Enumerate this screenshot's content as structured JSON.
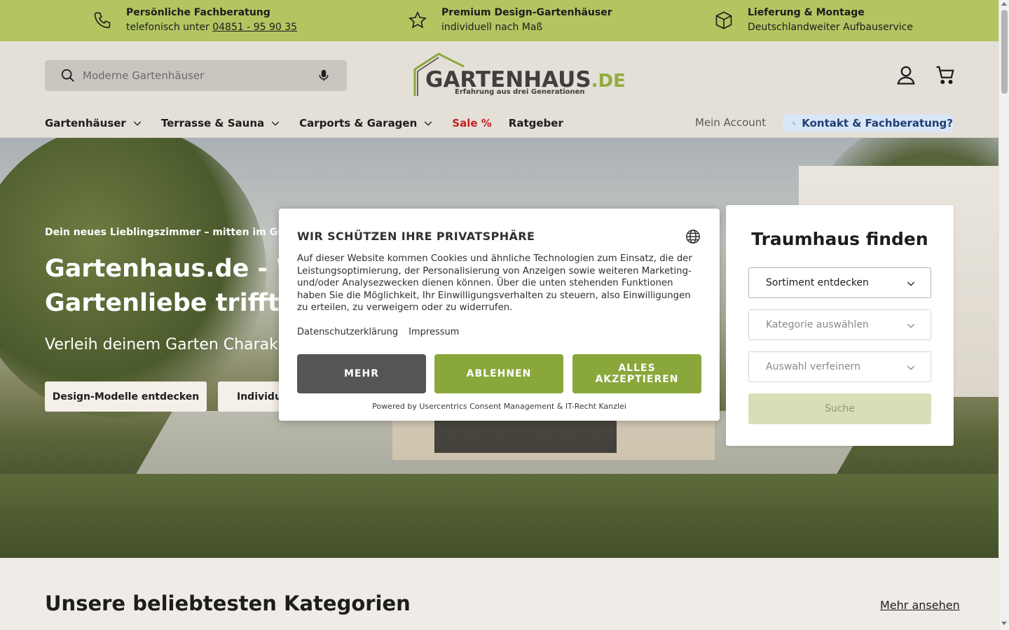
{
  "usp": [
    {
      "title": "Persönliche Fachberatung",
      "sub_prefix": "telefonisch unter ",
      "phone": "04851 - 95 90 35",
      "icon": "phone-icon"
    },
    {
      "title": "Premium Design-Gartenhäuser",
      "sub": "individuell nach Maß",
      "icon": "star-icon"
    },
    {
      "title": "Lieferung & Montage",
      "sub": "Deutschlandweiter Aufbauservice",
      "icon": "box-icon"
    }
  ],
  "header": {
    "search_placeholder": "Moderne Gartenhäuser",
    "logo_main": "GARTENHAUS",
    "logo_tld": ".DE",
    "logo_tagline": "Erfahrung aus drei Generationen",
    "nav": [
      "Gartenhäuser",
      "Terrasse & Sauna",
      "Carports & Garagen",
      "Sale %",
      "Ratgeber"
    ],
    "mein_account": "Mein Account",
    "kontakt": "Kontakt & Fachberatung?"
  },
  "hero": {
    "pre": "Dein neues Lieblingszimmer – mitten im Grün",
    "title": "Gartenhaus.de - Wo Design auf Gartenliebe trifft.",
    "sub": "Verleih deinem Garten Charakter",
    "btn1": "Design-Modelle entdecken",
    "btn2": "Individuell"
  },
  "finder": {
    "title": "Traumhaus finden",
    "select1": "Sortiment entdecken",
    "select2": "Kategorie auswählen",
    "select3": "Auswahl verfeinern",
    "search": "Suche"
  },
  "consent": {
    "title": "WIR SCHÜTZEN IHRE PRIVATSPHÄRE",
    "text": "Auf dieser Website kommen Cookies und ähnliche Technologien zum Einsatz, die der Leistungsoptimierung, der Personalisierung von Anzeigen sowie weiteren Marketing- und/oder Analysezwecken dienen können. Über die unten stehenden Funktionen haben Sie die Möglichkeit, Ihr Einwilligungsverhalten zu steuern, also Einwilligungen zu erteilen, zu verweigern oder zu widerrufen.",
    "link_privacy": "Datenschutzerklärung",
    "link_imprint": "Impressum",
    "btn_more": "MEHR",
    "btn_decline": "ABLEHNEN",
    "btn_accept": "ALLES AKZEPTIEREN",
    "powered": "Powered by Usercentrics Consent Management & IT-Recht Kanzlei"
  },
  "categories": {
    "title": "Unsere beliebtesten Kategorien",
    "more": "Mehr ansehen"
  },
  "colors": {
    "usp_bar": "#b2c561",
    "accent_green": "#8aa73b",
    "sale_red": "#c41f1f",
    "kontakt_bg": "#d9e6f5"
  }
}
